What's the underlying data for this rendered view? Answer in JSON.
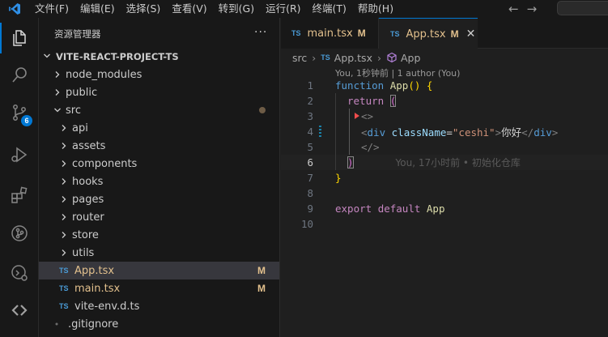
{
  "menu": [
    "文件(F)",
    "编辑(E)",
    "选择(S)",
    "查看(V)",
    "转到(G)",
    "运行(R)",
    "终端(T)",
    "帮助(H)"
  ],
  "nav": {
    "back": "←",
    "forward": "→"
  },
  "activity": {
    "scm_badge": "6"
  },
  "explorer": {
    "title": "资源管理器",
    "more": "···",
    "project": "VITE-REACT-PROJECT-TS",
    "items": [
      {
        "label": "node_modules",
        "type": "folder",
        "open": false
      },
      {
        "label": "public",
        "type": "folder",
        "open": false
      },
      {
        "label": "src",
        "type": "folder",
        "open": true
      },
      {
        "label": "api",
        "type": "folder",
        "open": false
      },
      {
        "label": "assets",
        "type": "folder",
        "open": false
      },
      {
        "label": "components",
        "type": "folder",
        "open": false
      },
      {
        "label": "hooks",
        "type": "folder",
        "open": false
      },
      {
        "label": "pages",
        "type": "folder",
        "open": false
      },
      {
        "label": "router",
        "type": "folder",
        "open": false
      },
      {
        "label": "store",
        "type": "folder",
        "open": false
      },
      {
        "label": "utils",
        "type": "folder",
        "open": false
      },
      {
        "label": "App.tsx",
        "type": "ts",
        "badge": "M"
      },
      {
        "label": "main.tsx",
        "type": "ts",
        "badge": "M"
      },
      {
        "label": "vite-env.d.ts",
        "type": "ts"
      },
      {
        "label": ".gitignore",
        "type": "file"
      }
    ]
  },
  "tabs": [
    {
      "icon": "TS",
      "label": "main.tsx",
      "badge": "M"
    },
    {
      "icon": "TS",
      "label": "App.tsx",
      "badge": "M",
      "close": "✕"
    }
  ],
  "breadcrumb": {
    "folder": "src",
    "file_icon": "TS",
    "file": "App.tsx",
    "symbol": "App",
    "sep": "›"
  },
  "codelens": "You, 1秒钟前 | 1 author (You)",
  "code": {
    "line_numbers": [
      "1",
      "2",
      "3",
      "4",
      "5",
      "6",
      "7",
      "8",
      "9",
      "10"
    ],
    "l1": {
      "kw": "function",
      "name": "App",
      "paren": "()",
      "brace": "{"
    },
    "l2": {
      "kw": "return",
      "paren": "("
    },
    "l3": {
      "frag_open": "<>"
    },
    "l4": {
      "lt": "<",
      "tag": "div",
      "attr": "className",
      "eq": "=",
      "str": "\"ceshi\"",
      "gt": ">",
      "text": "你好",
      "close_lt": "</",
      "close_tag": "div",
      "close_gt": ">"
    },
    "l5": {
      "frag_close": "</>"
    },
    "l6": {
      "paren": ")",
      "blame": "You, 17小时前 • 初始化仓库"
    },
    "l7": {
      "brace": "}"
    },
    "l9": {
      "kw1": "export",
      "kw2": "default",
      "name": "App"
    }
  },
  "colors": {
    "accent": "#0078d4",
    "modified": "#e2c08d",
    "ts": "#4a9bd6"
  }
}
